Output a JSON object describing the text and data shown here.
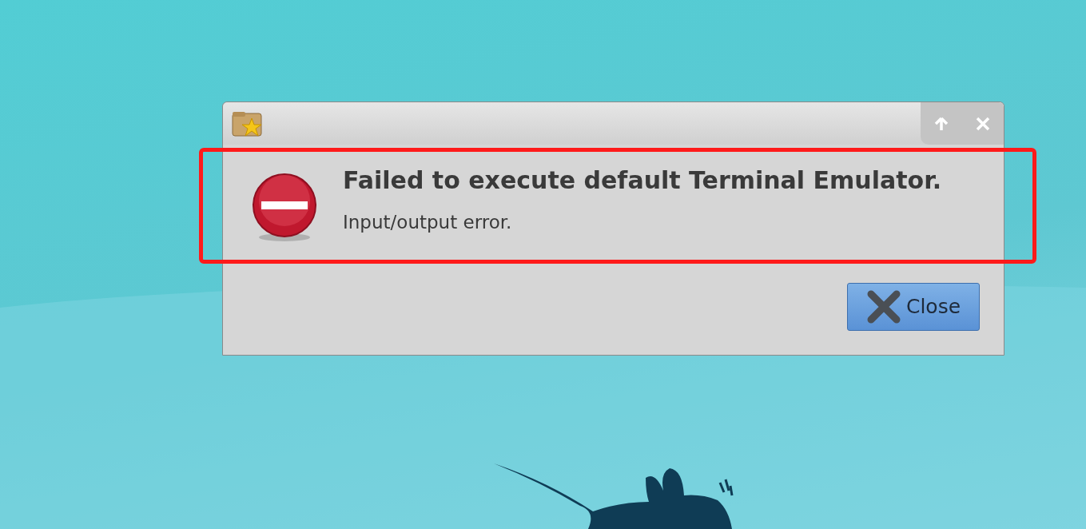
{
  "dialog": {
    "heading": "Failed to execute default Terminal Emulator.",
    "message": "Input/output error.",
    "buttons": [
      {
        "label": "Close"
      }
    ]
  }
}
